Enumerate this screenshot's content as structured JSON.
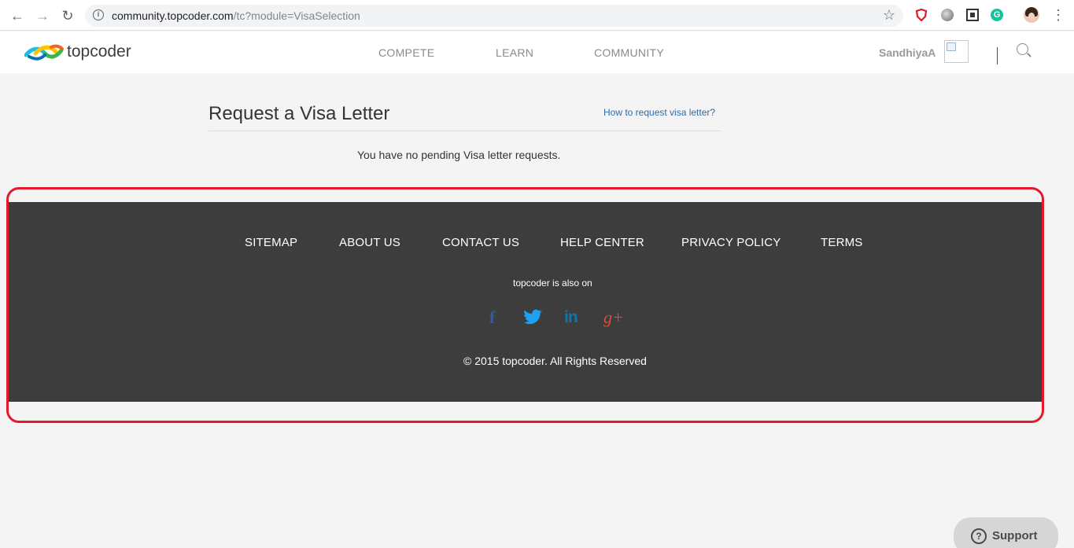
{
  "browser": {
    "back": "←",
    "forward": "→",
    "reload": "↻",
    "info_icon": "i",
    "url_host": "community.topcoder.com",
    "url_path": "/tc?module=VisaSelection",
    "star": "☆",
    "extension_g": "G",
    "menu": "⋮"
  },
  "header": {
    "logo_text": "topcoder",
    "nav": [
      "COMPETE",
      "LEARN",
      "COMMUNITY"
    ],
    "username": "SandhiyaA"
  },
  "main": {
    "title": "Request a Visa Letter",
    "help_link": "How to request visa letter?",
    "message": "You have no pending Visa letter requests."
  },
  "footer": {
    "links": [
      "SITEMAP",
      "ABOUT US",
      "CONTACT US",
      "HELP CENTER",
      "PRIVACY POLICY",
      "TERMS"
    ],
    "also_on": "topcoder is also on",
    "social": [
      {
        "name": "facebook",
        "glyph": "f",
        "color": "#3b5998"
      },
      {
        "name": "twitter",
        "glyph": "🐦",
        "color": "#1da1f2"
      },
      {
        "name": "linkedin",
        "glyph": "in",
        "color": "#0e76a8"
      },
      {
        "name": "google-plus",
        "glyph": "g+",
        "color": "#dd4b39"
      }
    ],
    "copyright": "© 2015 topcoder. All Rights Reserved"
  },
  "annotation": {
    "color": "#e21b2a"
  },
  "support": {
    "icon": "?",
    "label": "Support"
  }
}
